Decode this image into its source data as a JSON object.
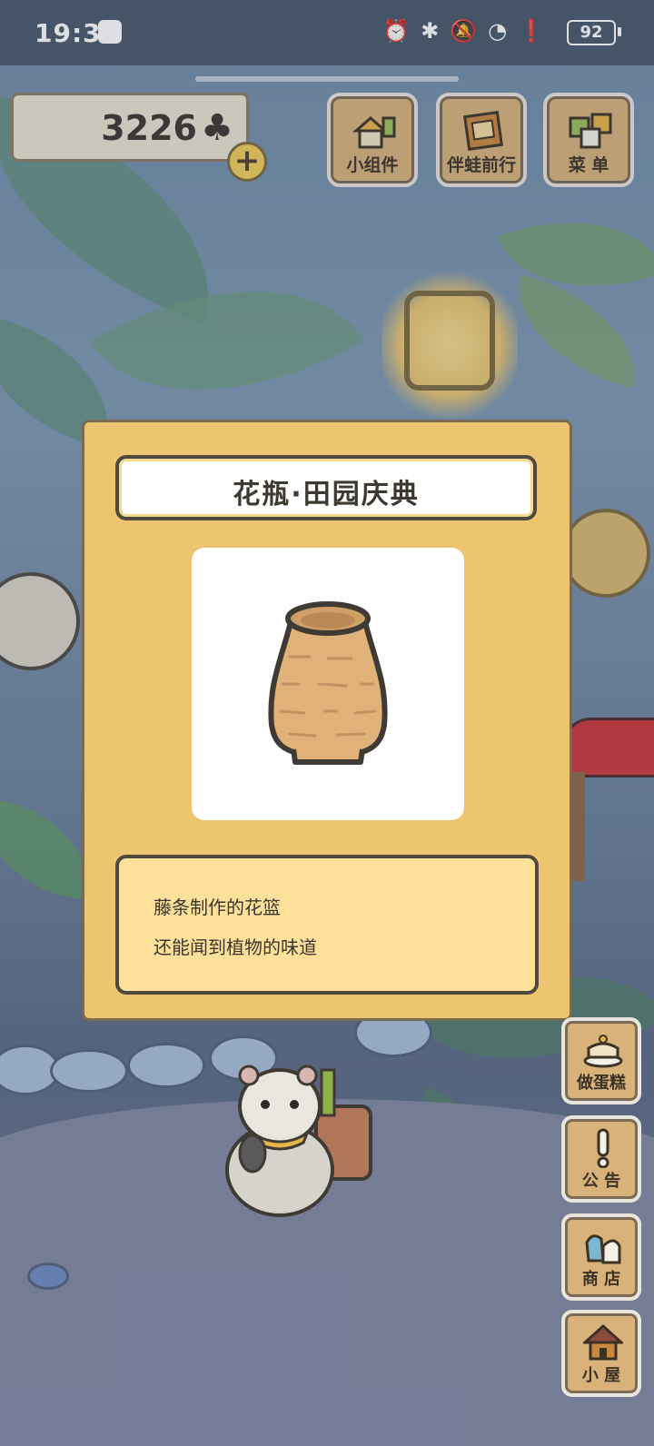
{
  "status_bar": {
    "time": "19:36",
    "battery": "92",
    "icons": [
      "alarm-icon",
      "bluetooth-icon",
      "mute-icon",
      "wifi-icon",
      "alert-icon"
    ]
  },
  "currency": {
    "clover_count": "3226",
    "clover_symbol": "♣",
    "add_symbol": "+"
  },
  "top_buttons": [
    {
      "label": "小组件",
      "icon": "widget-icon"
    },
    {
      "label": "伴蛙前行",
      "icon": "journal-icon"
    },
    {
      "label": "菜 单",
      "icon": "menu-icon"
    }
  ],
  "item_dialog": {
    "title": "花瓶·田园庆典",
    "image": "rattan-vase-icon",
    "description_lines": [
      "藤条制作的花篮",
      "还能闻到植物的味道"
    ]
  },
  "side_buttons": [
    {
      "label": "做蛋糕",
      "icon": "cake-icon"
    },
    {
      "label": "公 告",
      "icon": "notice-icon"
    },
    {
      "label": "商 店",
      "icon": "shop-icon"
    },
    {
      "label": "小 屋",
      "icon": "house-icon"
    }
  ],
  "colors": {
    "dialog_bg": "#edc46f",
    "title_box": "#ffffff",
    "description_box": "#fde09a",
    "wood_button": "#d9b27a",
    "outline": "#4e4a42"
  }
}
